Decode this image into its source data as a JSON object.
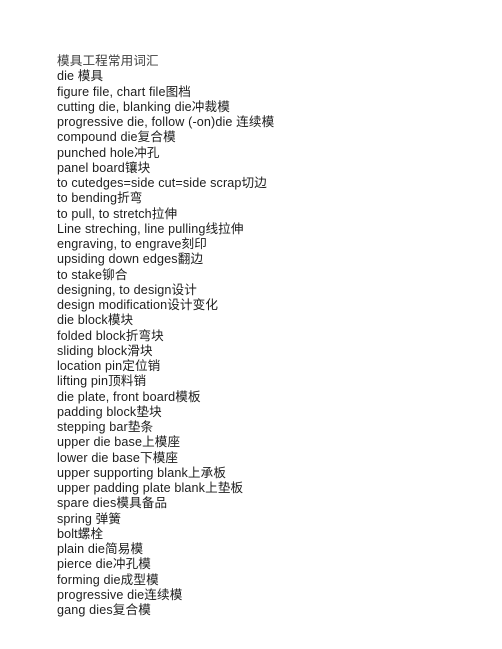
{
  "document": {
    "title": "模具工程常用词汇",
    "background_color": "#ffffff",
    "text_color": "#1c1c1c",
    "lines": [
      {
        "text": "模具工程常用词汇"
      },
      {
        "text": "die 模具"
      },
      {
        "text": "figure file, chart file图档"
      },
      {
        "text": "cutting die, blanking die冲裁模"
      },
      {
        "text": "progressive die, follow (-on)die 连续模"
      },
      {
        "text": "compound die复合模"
      },
      {
        "text": "punched hole冲孔"
      },
      {
        "text": "panel board镶块"
      },
      {
        "text": "to cutedges=side cut=side scrap切边"
      },
      {
        "text": "to bending折弯"
      },
      {
        "text": "to pull, to stretch拉伸"
      },
      {
        "text": "Line streching, line pulling线拉伸"
      },
      {
        "text": "engraving, to engrave刻印"
      },
      {
        "text": "upsiding down edges翻边"
      },
      {
        "text": "to stake铆合"
      },
      {
        "text": "designing, to design设计"
      },
      {
        "text": "design modification设计变化"
      },
      {
        "text": "die block模块"
      },
      {
        "text": "folded block折弯块"
      },
      {
        "text": "sliding block滑块"
      },
      {
        "text": "location pin定位销"
      },
      {
        "text": "lifting pin顶料销"
      },
      {
        "text": "die plate, front board模板"
      },
      {
        "text": "padding block垫块"
      },
      {
        "text": "stepping bar垫条"
      },
      {
        "text": "upper die base上模座"
      },
      {
        "text": "lower die base下模座"
      },
      {
        "text": "upper supporting blank上承板"
      },
      {
        "text": "upper padding plate blank上垫板"
      },
      {
        "text": "spare dies模具备品"
      },
      {
        "text": "spring 弹簧"
      },
      {
        "text": "bolt螺栓"
      },
      {
        "text": "plain die简易模"
      },
      {
        "text": "pierce die冲孔模"
      },
      {
        "text": "forming die成型模"
      },
      {
        "text": "progressive die连续模"
      },
      {
        "text": "gang dies复合模"
      }
    ]
  }
}
